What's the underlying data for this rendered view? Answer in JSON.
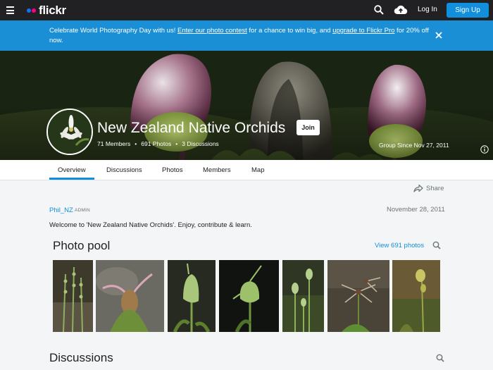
{
  "nav": {
    "logo_text": "flickr",
    "login_label": "Log In",
    "signup_label": "Sign Up"
  },
  "banner": {
    "text_1": "Celebrate World Photography Day with us! ",
    "link_1": "Enter our photo contest",
    "text_2": " for a chance to win big, and ",
    "link_2": "upgrade to Flickr Pro",
    "text_3": " for 20% off now."
  },
  "group": {
    "title": "New Zealand Native Orchids",
    "join_label": "Join",
    "members": "71 Members",
    "photos": "691 Photos",
    "discussions": "3 Discussions",
    "since": "Group Since Nov 27, 2011"
  },
  "tabs": [
    {
      "label": "Overview",
      "active": true
    },
    {
      "label": "Discussions",
      "active": false
    },
    {
      "label": "Photos",
      "active": false
    },
    {
      "label": "Members",
      "active": false
    },
    {
      "label": "Map",
      "active": false
    }
  ],
  "post": {
    "share_label": "Share",
    "author": "Phil_NZ",
    "role": "ADMIN",
    "date": "November 28, 2011",
    "text": "Welcome to 'New Zealand Native Orchids'. Enjoy, contribute & learn."
  },
  "photo_pool": {
    "title": "Photo pool",
    "view_label": "View 691 photos",
    "photos": [
      {
        "name": "photo-green-spikes"
      },
      {
        "name": "photo-pink-hood"
      },
      {
        "name": "photo-green-hood"
      },
      {
        "name": "photo-greenhood-dark"
      },
      {
        "name": "photo-moss-orchids"
      },
      {
        "name": "photo-spider-orchid"
      },
      {
        "name": "photo-yellow-orchid"
      }
    ]
  },
  "discussions_section": {
    "title": "Discussions"
  },
  "colors": {
    "accent": "#128fdc",
    "banner": "#1a8fd6",
    "nav_bg": "#212124"
  }
}
